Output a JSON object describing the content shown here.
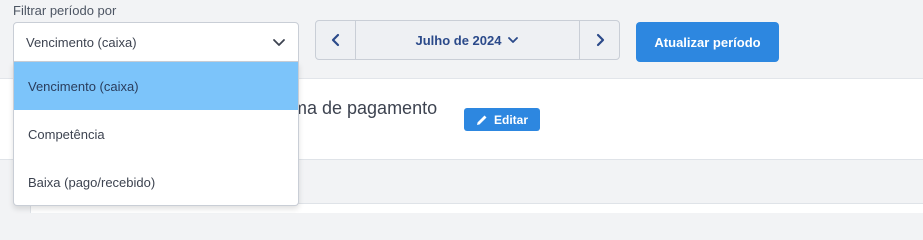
{
  "filter": {
    "label": "Filtrar período por",
    "selected": "Vencimento (caixa)",
    "options": [
      "Vencimento (caixa)",
      "Competência",
      "Baixa (pago/recebido)"
    ]
  },
  "period": {
    "month": "Julho de 2024"
  },
  "update_button": "Atualizar período",
  "panel": {
    "title": "rma de pagamento",
    "edit_label": "Editar"
  },
  "colors": {
    "accent": "#2d87e0",
    "selected_option": "#7cc4fa",
    "month_text": "#2b4a8a"
  }
}
